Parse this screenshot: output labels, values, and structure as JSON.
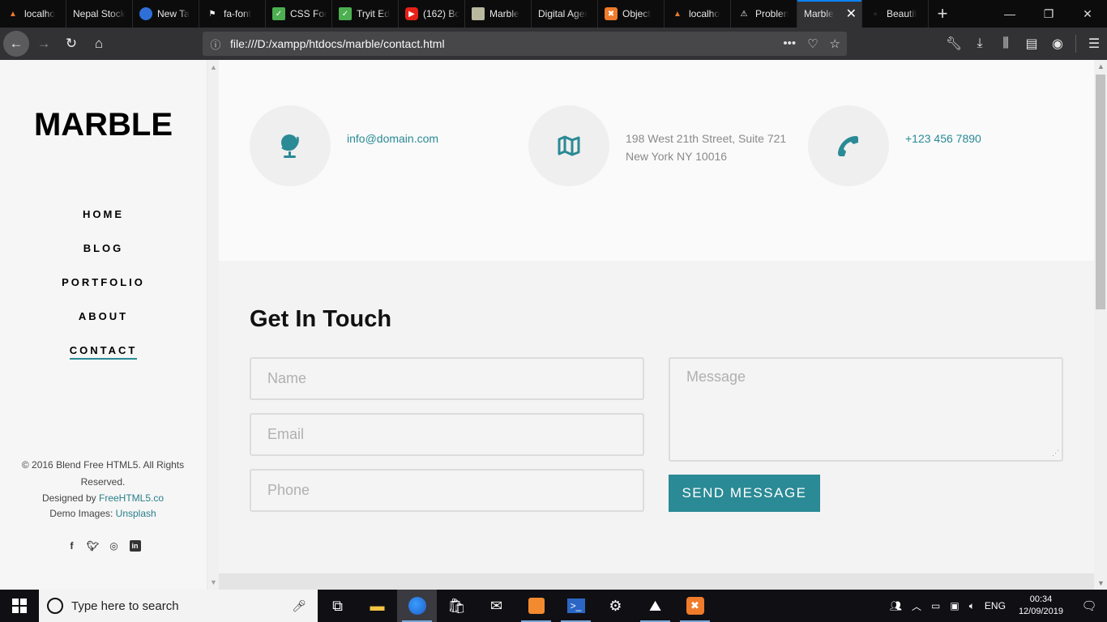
{
  "browser": {
    "tabs": [
      {
        "label": "localho",
        "icon": "xampp-icon"
      },
      {
        "label": "Nepal Stock",
        "icon": ""
      },
      {
        "label": "New Ta",
        "icon": "firefox-icon"
      },
      {
        "label": "fa-font",
        "icon": "flag-icon"
      },
      {
        "label": "CSS For",
        "icon": "chart-icon"
      },
      {
        "label": "Tryit Ed",
        "icon": "chart-icon"
      },
      {
        "label": "(162) Bo",
        "icon": "youtube-icon"
      },
      {
        "label": "Marble",
        "icon": "image-icon"
      },
      {
        "label": "Digital Ager",
        "icon": ""
      },
      {
        "label": "Object",
        "icon": "xampp-icon"
      },
      {
        "label": "localho",
        "icon": "xampp-icon"
      },
      {
        "label": "Problen",
        "icon": "warning-icon"
      },
      {
        "label": "Marble",
        "icon": "",
        "active": true
      },
      {
        "label": "Beautif",
        "icon": "user-icon"
      }
    ],
    "url": "file:///D:/xampp/htdocs/marble/contact.html"
  },
  "sidebar": {
    "logo": "MARBLE",
    "menu": [
      "HOME",
      "BLOG",
      "PORTFOLIO",
      "ABOUT",
      "CONTACT"
    ],
    "active": "CONTACT",
    "copyright": "© 2016 Blend Free HTML5. All Rights Reserved.",
    "designed_by_prefix": "Designed by ",
    "designed_by_link": "FreeHTML5.co",
    "demo_images_prefix": "Demo Images: ",
    "demo_images_link": "Unsplash"
  },
  "contact_info": {
    "email": "info@domain.com",
    "address_line1": "198 West 21th Street, Suite 721",
    "address_line2": "New York NY 10016",
    "phone": "+123 456 7890"
  },
  "form": {
    "heading": "Get In Touch",
    "name_placeholder": "Name",
    "email_placeholder": "Email",
    "phone_placeholder": "Phone",
    "message_placeholder": "Message",
    "submit_label": "SEND MESSAGE"
  },
  "colors": {
    "accent": "#2a8a95"
  },
  "taskbar": {
    "search_placeholder": "Type here to search",
    "language": "ENG",
    "time": "00:34",
    "date": "12/09/2019"
  }
}
